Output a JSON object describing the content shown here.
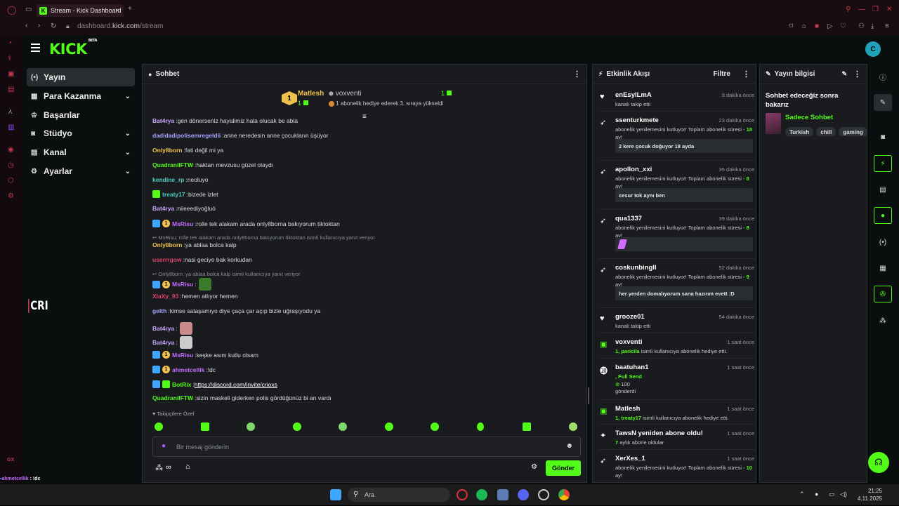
{
  "browser": {
    "tab_title": "Stream - Kick Dashboard",
    "url_prefix": "dashboard.",
    "url_domain": "kick.com",
    "url_path": "/stream"
  },
  "brand": {
    "logo": "KICK",
    "beta": "BETA"
  },
  "nav": {
    "items": [
      {
        "label": "Yayın",
        "icon": "broadcast-icon"
      },
      {
        "label": "Para Kazanma",
        "icon": "money-icon"
      },
      {
        "label": "Başarılar",
        "icon": "trophy-icon"
      },
      {
        "label": "Stüdyo",
        "icon": "camera-icon"
      },
      {
        "label": "Kanal",
        "icon": "layout-icon"
      },
      {
        "label": "Ayarlar",
        "icon": "gear-icon"
      }
    ]
  },
  "overlay_logo": "CRI",
  "chat": {
    "title": "Sohbet",
    "pinned": {
      "rank": "1",
      "leader": "Matlesh",
      "leader_count": "1",
      "gifter": "voxventi",
      "gifter_count": "1",
      "note": "1 abonelik hediye ederek 3. sıraya yükseldi"
    },
    "messages": [
      {
        "user": "Bat4rya",
        "color": "#c9a3ff",
        "text": " gen dönerseniz hayalimiz hala olucak be abla"
      },
      {
        "user": "dadidadipolisemregeldii",
        "color": "#a8a4ff",
        "text": " anne neredesin anne çocukların üşüyor"
      },
      {
        "user": "Only8born",
        "color": "#f0c14b",
        "text": " fati değil mi ya"
      },
      {
        "user": "QuadranilFTW",
        "color": "#53fc18",
        "text": " haktan mevzusu güzel olaydı"
      },
      {
        "user": "kendine_rp",
        "color": "#4fd1c5",
        "text": " neoluyo"
      },
      {
        "user": "treaty17",
        "color": "#4fd1c5",
        "text": " bizede izlet"
      },
      {
        "user": "Bat4rya",
        "color": "#c9a3ff",
        "text": " niieeediyoğluö"
      },
      {
        "user": "MsRisu",
        "color": "#c56bff",
        "text": " rolle tek alakam arada only8borna bakıyorum tiktoktan"
      },
      {
        "user": "Only8born",
        "color": "#f0c14b",
        "text": " ya ablaa bolca kalp"
      },
      {
        "user": "userrrgow",
        "color": "#e0416a",
        "text": " nasi geciyo bak korkudan"
      },
      {
        "user": "MsRisu",
        "color": "#c56bff",
        "text": ""
      },
      {
        "user": "XlaXy_93",
        "color": "#e0416a",
        "text": " hemen atlıyor hemen"
      },
      {
        "user": "gelth",
        "color": "#a8a4ff",
        "text": " kimse sataşamıyo diye çaça çar açıp bizle uğraşıyodu ya"
      },
      {
        "user": "Bat4rya",
        "color": "#c9a3ff",
        "text": ""
      },
      {
        "user": "Bat4rya",
        "color": "#c9a3ff",
        "text": ""
      },
      {
        "user": "MsRisu",
        "color": "#c56bff",
        "text": " keşke asım kutlu olsam"
      },
      {
        "user": "ahmetcellik",
        "color": "#c56bff",
        "text": " !dc"
      },
      {
        "user": "BotRix",
        "color": "#53fc18",
        "text": " https://discord.com/invite/crioxs"
      },
      {
        "user": "QuadranilFTW",
        "color": "#53fc18",
        "text": " sizin maskeli giderken polis gördüğünüz bi an vardı"
      }
    ],
    "replies": [
      "MsRisu: rolle tek alakam arada only8borna bakıyorum tiktoktan isimli kullanıcıya yanıt veriyor",
      "Only8born: ya ablaa bolca kalp isimli kullanıcıya yanıt veriyor"
    ],
    "followers_only": "Takipçilere Özel",
    "input_placeholder": "Bir mesaj gönderin",
    "send_label": "Gönder"
  },
  "activity": {
    "title": "Etkinlik Akışı",
    "filter_label": "Filtre",
    "events": [
      {
        "icon": "heart-icon",
        "name": "enEsyILmA",
        "time": "9 dakika önce",
        "desc": "kanalı takip etti",
        "box": ""
      },
      {
        "icon": "rocket-icon",
        "name": "ssenturkmete",
        "time": "23 dakika önce",
        "desc_pre": "abonelik yenilemesini kutluyor! Toplam abonelik süresi - ",
        "months": "18",
        "desc_post": " ay!",
        "box": "2 kere çocuk doğuyor 18 ayda"
      },
      {
        "icon": "rocket-icon",
        "name": "apollon_xxi",
        "time": "35 dakika önce",
        "desc_pre": "abonelik yenilemesini kutluyor! Toplam abonelik süresi - ",
        "months": "8",
        "desc_post": " ay!",
        "box": "cesur tok aynı ben"
      },
      {
        "icon": "rocket-icon",
        "name": "qua1337",
        "time": "39 dakika önce",
        "desc_pre": "abonelik yenilemesini kutluyor! Toplam abonelik süresi - ",
        "months": "8",
        "desc_post": " ay!",
        "box": ""
      },
      {
        "icon": "rocket-icon",
        "name": "coskunbingll",
        "time": "52 dakika önce",
        "desc_pre": "abonelik yenilemesini kutluyor! Toplam abonelik süresi - ",
        "months": "9",
        "desc_post": " ay!",
        "box": "her yerden domalıyorum sana hazırım evett :D"
      },
      {
        "icon": "heart-icon",
        "name": "grooze01",
        "time": "54 dakika önce",
        "desc": "kanalı takip etti",
        "box": ""
      },
      {
        "icon": "gift-icon",
        "name": "voxventi",
        "time": "1 saat önce",
        "desc_g": "1, paricila",
        "desc": " isimli kullanıcıya abonelik hediye etti."
      },
      {
        "icon": "kick-icon",
        "name": "baatuhan1",
        "time": "1 saat önce",
        "desc_g": ", Full Send",
        "amount": "100",
        "desc": "gönderdi"
      },
      {
        "icon": "gift-icon",
        "name": "Matlesh",
        "time": "1 saat önce",
        "desc_g": "1, treaty17",
        "desc": " isimli kullanıcıya abonelik hediye etti."
      },
      {
        "icon": "sparkle-icon",
        "name": "TawsN yeniden abone oldu!",
        "time": "1 saat önce",
        "desc_g": "7",
        "desc": " aylık abone oldular"
      },
      {
        "icon": "rocket-icon",
        "name": "XerXes_1",
        "time": "1 saat önce",
        "desc_pre": "abonelik yenilemesini kutluyor! Toplam abonelik süresi - ",
        "months": "10",
        "desc_post": " ay!"
      }
    ]
  },
  "stream_info": {
    "title": "Yayın bilgisi",
    "stream_title": "Sohbet edeceğiz sonra bakarız",
    "category": "Sadece Sohbet",
    "tags": [
      "Turkish",
      "chill",
      "gaming"
    ]
  },
  "overlay_chat": [
    {
      "user": "ahmetcellik",
      "color": "#c56bff",
      "text": " : !dc"
    },
    {
      "user": "BotRix",
      "color": "#53fc18",
      "text": " : https://discord.com/invite/crioxs"
    },
    {
      "user": "QuadranilFTW",
      "color": "#53fc18",
      "text": " : sizin maskeli giderken polis gördüğünüz bi an vardı"
    }
  ],
  "taskbar": {
    "search_placeholder": "Ara",
    "time": "21:25",
    "date": "4.11.2025",
    "corner_label": "GX"
  },
  "colors": {
    "accent": "#53fc18",
    "panel": "#191b1f",
    "bg": "#0b0e0f"
  }
}
